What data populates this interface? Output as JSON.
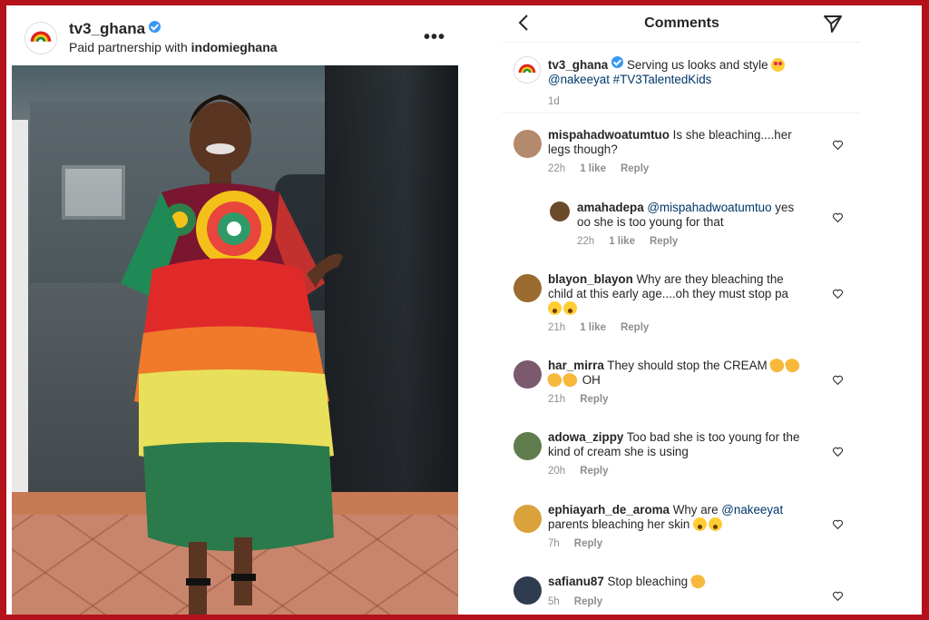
{
  "post": {
    "author": "tv3_ghana",
    "partner_prefix": "Paid partnership with ",
    "partner_name": "indomieghana",
    "more_label": "•••"
  },
  "comments_panel": {
    "title": "Comments",
    "caption": {
      "user": "tv3_ghana",
      "text": " Serving us looks and style ",
      "mentions": "@nakeeyat #TV3TalentedKids",
      "time": "1d"
    },
    "items": [
      {
        "user": "mispahadwoatumtuo",
        "text": " Is she bleaching....her",
        "text2": "legs though?",
        "time": "22h",
        "likes": "1 like",
        "reply": "Reply"
      },
      {
        "user": "amahadepa",
        "mention": " @mispahadwoatumtuo",
        "text": "  yes",
        "text2": "oo she is too young for that",
        "time": "22h",
        "likes": "1 like",
        "reply": "Reply"
      },
      {
        "user": "blayon_blayon",
        "text": " Why are they bleaching the",
        "text2": "child at this early age....oh they must stop pa",
        "time": "21h",
        "likes": "1 like",
        "reply": "Reply"
      },
      {
        "user": "har_mirra",
        "text": " They should stop the CREAM ",
        "text2": " OH",
        "time": "21h",
        "reply": "Reply"
      },
      {
        "user": "adowa_zippy",
        "text": " Too bad she is too young for the",
        "text2": "kind of cream she is using",
        "time": "20h",
        "reply": "Reply"
      },
      {
        "user": "ephiayarh_de_aroma",
        "text": " Why are ",
        "mention": "@nakeeyat",
        "text2": "parents bleaching her skin ",
        "time": "7h",
        "reply": "Reply"
      },
      {
        "user": "safianu87",
        "text": " Stop bleaching ",
        "time": "5h",
        "reply": "Reply"
      }
    ]
  },
  "colors": {
    "frame": "#b3121a",
    "verified": "#3897f0",
    "mention": "#00376b",
    "meta": "#8e8e8e"
  },
  "icons": [
    "verified-icon",
    "more-icon",
    "back-icon",
    "send-icon",
    "heart-icon"
  ]
}
